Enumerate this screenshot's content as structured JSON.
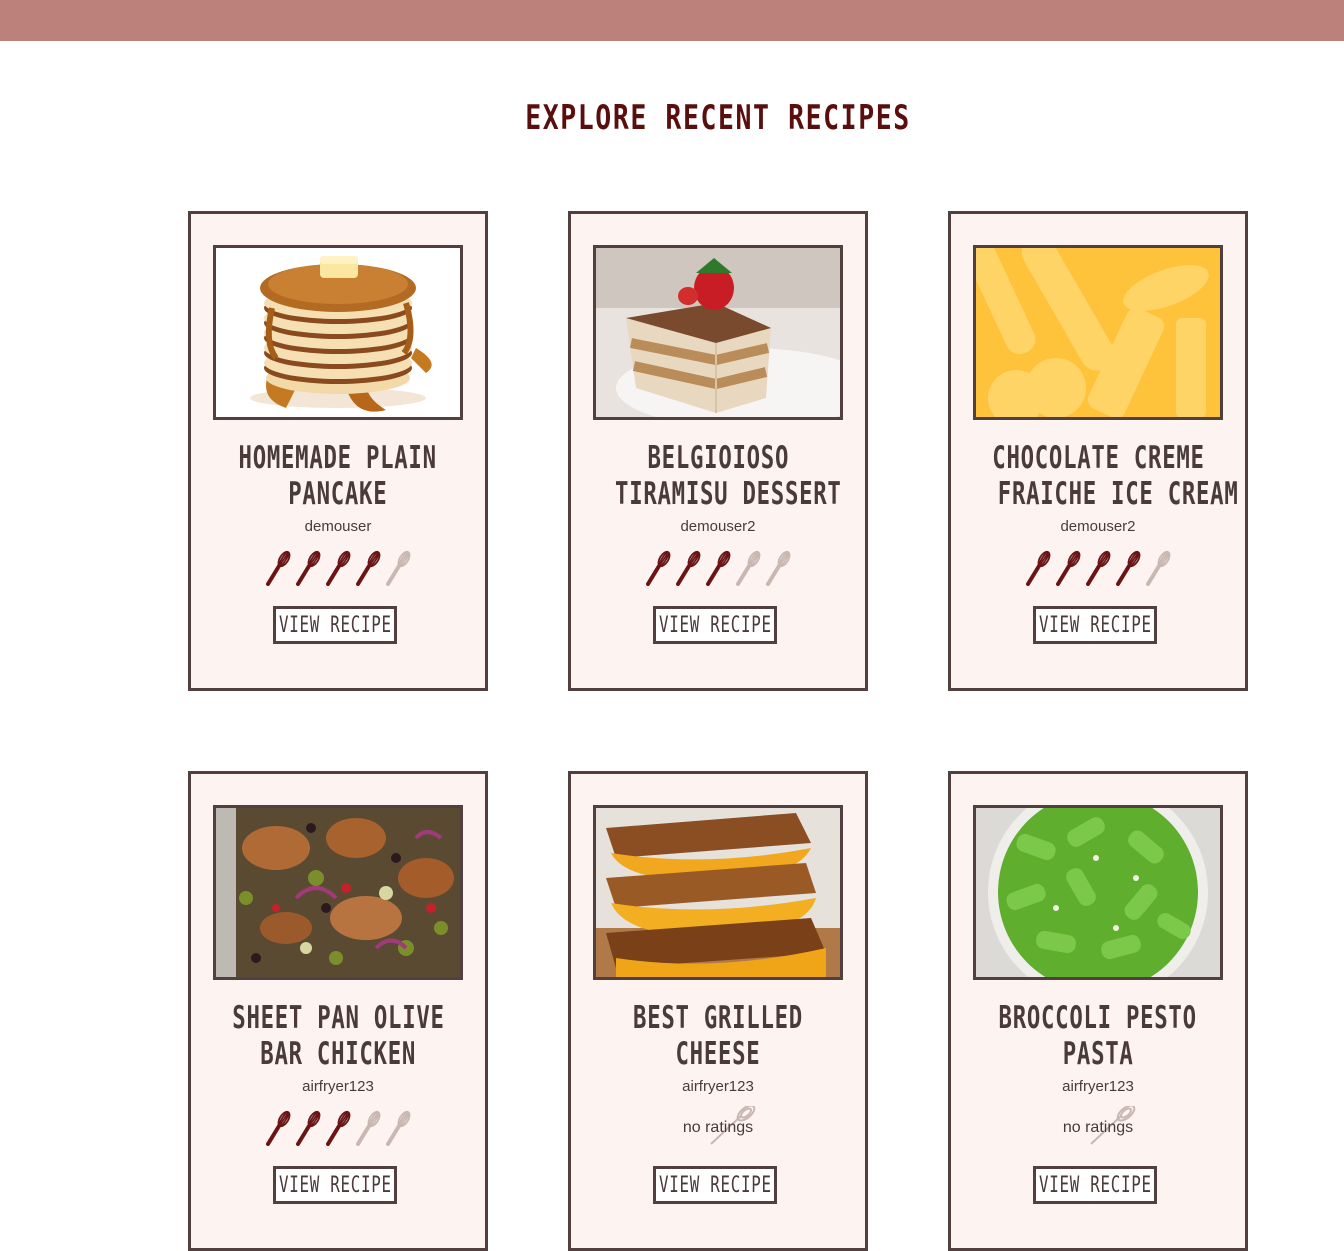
{
  "header": {
    "title": "Explore Recent Recipes"
  },
  "colors": {
    "topbar": "#bc817a",
    "title": "#5b0e0e",
    "border": "#523f3f",
    "card_bg": "#fdf4f1",
    "whisk_on": "#6b1414",
    "whisk_off": "#c9b7b2"
  },
  "recipes": [
    {
      "title_line1": "HOMEMADE PLAIN",
      "title_line2": "PANCAKE",
      "author": "demouser",
      "rating": 4,
      "image": "pancake-stack",
      "button": "VIEW RECIPE"
    },
    {
      "title_line1": "BELGIOIOSO",
      "title_line2": "TIRAMISU DESSERT",
      "author": "demouser2",
      "rating": 3,
      "image": "tiramisu",
      "button": "VIEW RECIPE"
    },
    {
      "title_line1": "CHOCOLATE CREME",
      "title_line2": "FRAICHE ICE CREAM",
      "author": "demouser2",
      "rating": 4,
      "image": "placeholder-kitchen",
      "button": "VIEW RECIPE"
    },
    {
      "title_line1": "SHEET PAN OLIVE",
      "title_line2": "BAR CHICKEN",
      "author": "airfryer123",
      "rating": 3,
      "image": "sheet-pan-chicken",
      "button": "VIEW RECIPE"
    },
    {
      "title_line1": "BEST GRILLED",
      "title_line2": "CHEESE",
      "author": "airfryer123",
      "rating": 0,
      "rating_text": "no ratings",
      "image": "grilled-cheese",
      "button": "VIEW RECIPE"
    },
    {
      "title_line1": "BROCCOLI PESTO",
      "title_line2": "PASTA",
      "author": "airfryer123",
      "rating": 0,
      "rating_text": "no ratings",
      "image": "pesto-pasta",
      "button": "VIEW RECIPE"
    }
  ],
  "max_rating": 5
}
